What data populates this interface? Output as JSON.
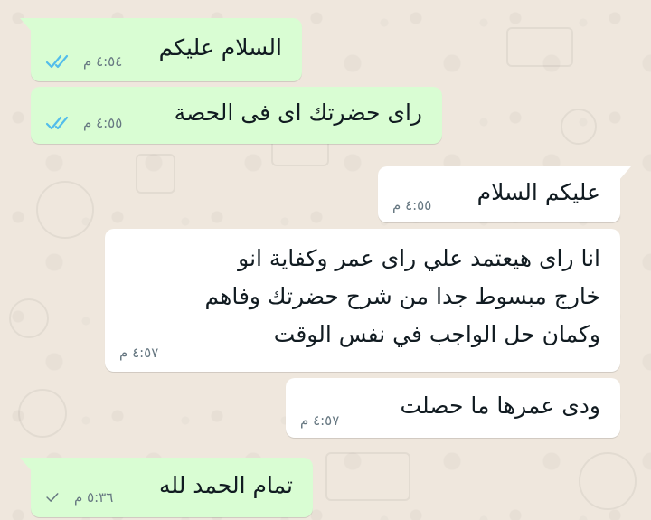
{
  "messages": [
    {
      "direction": "out",
      "text": "السلام عليكم",
      "time": "٤:٥٤ م",
      "status": "read"
    },
    {
      "direction": "out",
      "text": "راى حضرتك اى فى الحصة",
      "time": "٤:٥٥ م",
      "status": "read"
    },
    {
      "direction": "in",
      "text": "عليكم السلام",
      "time": "٤:٥٥ م"
    },
    {
      "direction": "in",
      "text": "انا راى هيعتمد علي راى عمر وكفاية انو\nخارج مبسوط جدا من شرح حضرتك وفاهم\nوكمان حل الواجب في نفس الوقت",
      "time": "٤:٥٧ م"
    },
    {
      "direction": "in",
      "text": "ودى عمرها ما حصلت",
      "time": "٤:٥٧ م"
    },
    {
      "direction": "out",
      "text": "تمام الحمد لله",
      "time": "٥:٣٦ م",
      "status": "sent"
    }
  ],
  "colors": {
    "outgoing_bubble": "#d9fdd3",
    "incoming_bubble": "#ffffff",
    "read_check": "#53bdeb",
    "sent_check": "#667781",
    "wallpaper": "#efe7dd"
  },
  "icons": {
    "read_status": "double-check-icon",
    "sent_status": "single-check-icon"
  }
}
